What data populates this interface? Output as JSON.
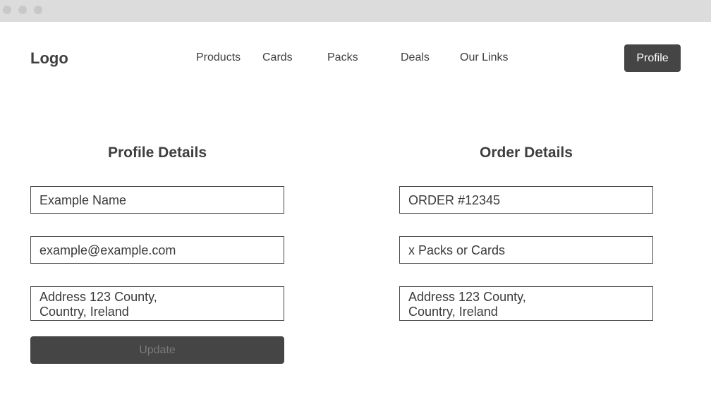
{
  "header": {
    "logo": "Logo",
    "nav": [
      "Products",
      "Cards",
      "Packs",
      "Deals",
      "Our Links"
    ],
    "profile_button": "Profile"
  },
  "profile_details": {
    "title": "Profile Details",
    "name": "Example Name",
    "email": "example@example.com",
    "address": "Address 123 County,\nCountry, Ireland",
    "update_button": "Update"
  },
  "order_details": {
    "title": "Order Details",
    "order_number": "ORDER #12345",
    "quantity": "x Packs or Cards",
    "address": "Address 123 County,\nCountry, Ireland"
  }
}
